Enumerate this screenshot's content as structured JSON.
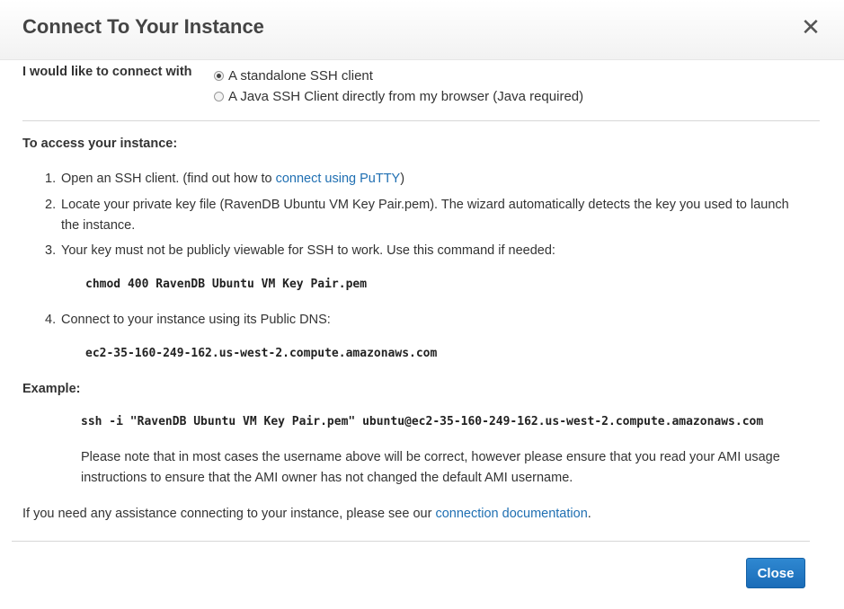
{
  "dialog": {
    "title": "Connect To Your Instance",
    "close_icon": "close-icon"
  },
  "connect_with": {
    "label": "I would like to connect with",
    "options": [
      {
        "label": "A standalone SSH client",
        "selected": true
      },
      {
        "label": "A Java SSH Client directly from my browser (Java required)",
        "selected": false
      }
    ]
  },
  "access": {
    "heading": "To access your instance:",
    "steps": [
      {
        "num": "1.",
        "text_before": "Open an SSH client. (find out how to",
        "link": "connect using PuTTY",
        "text_after": ")"
      },
      {
        "num": "2.",
        "text": "Locate your private key file (RavenDB Ubuntu VM Key Pair.pem). The wizard automatically detects the key you used to launch the instance."
      },
      {
        "num": "3.",
        "text": "Your key must not be publicly viewable for SSH to work. Use this command if needed:",
        "command": "chmod 400 RavenDB Ubuntu VM Key Pair.pem"
      },
      {
        "num": "4.",
        "text": "Connect to your instance using its Public DNS:",
        "command": "ec2-35-160-249-162.us-west-2.compute.amazonaws.com"
      }
    ]
  },
  "example": {
    "heading": "Example:",
    "command": "ssh -i \"RavenDB Ubuntu VM Key Pair.pem\" ubuntu@ec2-35-160-249-162.us-west-2.compute.amazonaws.com",
    "note": "Please note that in most cases the username above will be correct, however please ensure that you read your AMI usage instructions to ensure that the AMI owner has not changed the default AMI username."
  },
  "assistance": {
    "text": "If you need any assistance connecting to your instance, please see our",
    "link": "connection documentation",
    "suffix": "."
  },
  "footer": {
    "close_label": "Close"
  }
}
